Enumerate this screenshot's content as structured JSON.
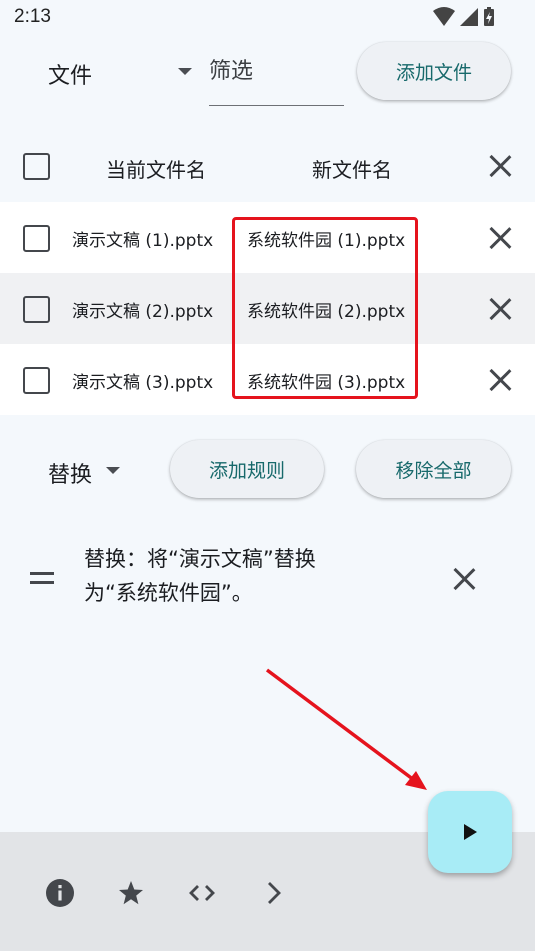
{
  "status_bar": {
    "time": "2:13"
  },
  "files_toolbar": {
    "file_type": "文件",
    "filter_placeholder": "筛选",
    "add_file_label": "添加文件"
  },
  "table": {
    "header_current": "当前文件名",
    "header_new": "新文件名",
    "rows": [
      {
        "current": "演示文稿 (1).pptx",
        "new": "系统软件园 (1).pptx"
      },
      {
        "current": "演示文稿 (2).pptx",
        "new": "系统软件园 (2).pptx"
      },
      {
        "current": "演示文稿 (3).pptx",
        "new": "系统软件园 (3).pptx"
      }
    ]
  },
  "rules_toolbar": {
    "rule_type": "替换",
    "add_rule_label": "添加规则",
    "remove_all_label": "移除全部"
  },
  "rules": [
    {
      "text": "替换：将“演示文稿”替换为“系统软件园”。"
    }
  ],
  "colors": {
    "accent_text": "#17696b",
    "fab": "#a8ecf6",
    "highlight": "#e5131d"
  },
  "bottom_bar": {
    "icons": [
      "info-icon",
      "star-icon",
      "code-icon",
      "chevron-right-icon"
    ]
  },
  "fab": {
    "icon": "play-icon"
  }
}
